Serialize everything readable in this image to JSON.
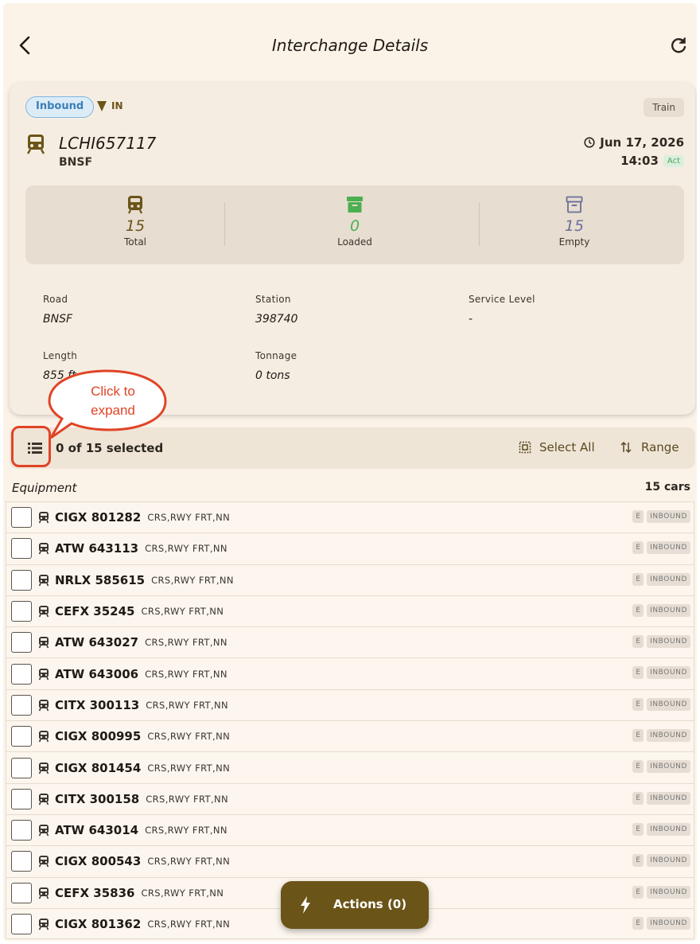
{
  "header": {
    "title": "Interchange Details"
  },
  "summary": {
    "direction_pill": "Inbound",
    "direction_tag": "IN",
    "type_badge": "Train",
    "train_id": "LCHI657117",
    "road": "BNSF",
    "date": "Jun 17, 2026",
    "time": "14:03",
    "time_status": "Act",
    "stats": [
      {
        "value": "15",
        "label": "Total",
        "color": "#6b5418"
      },
      {
        "value": "0",
        "label": "Loaded",
        "color": "#4caf50"
      },
      {
        "value": "15",
        "label": "Empty",
        "color": "#6b6f9a"
      }
    ],
    "fields": {
      "road_label": "Road",
      "road_value": "BNSF",
      "station_label": "Station",
      "station_value": "398740",
      "service_label": "Service Level",
      "service_value": "-",
      "length_label": "Length",
      "length_value": "855 ft",
      "tonnage_label": "Tonnage",
      "tonnage_value": "0 tons"
    }
  },
  "selection": {
    "count_text": "0 of 15 selected",
    "select_all_label": "Select All",
    "range_label": "Range"
  },
  "annotation": {
    "callout_line1": "Click to",
    "callout_line2": "expand"
  },
  "equipment": {
    "heading": "Equipment",
    "count": "15 cars",
    "rows": [
      {
        "id": "CIGX 801282",
        "desc": "CRS,RWY FRT,NN",
        "load": "E",
        "status": "INBOUND"
      },
      {
        "id": "ATW 643113",
        "desc": "CRS,RWY FRT,NN",
        "load": "E",
        "status": "INBOUND"
      },
      {
        "id": "NRLX 585615",
        "desc": "CRS,RWY FRT,NN",
        "load": "E",
        "status": "INBOUND"
      },
      {
        "id": "CEFX 35245",
        "desc": "CRS,RWY FRT,NN",
        "load": "E",
        "status": "INBOUND"
      },
      {
        "id": "ATW 643027",
        "desc": "CRS,RWY FRT,NN",
        "load": "E",
        "status": "INBOUND"
      },
      {
        "id": "ATW 643006",
        "desc": "CRS,RWY FRT,NN",
        "load": "E",
        "status": "INBOUND"
      },
      {
        "id": "CITX 300113",
        "desc": "CRS,RWY FRT,NN",
        "load": "E",
        "status": "INBOUND"
      },
      {
        "id": "CIGX 800995",
        "desc": "CRS,RWY FRT,NN",
        "load": "E",
        "status": "INBOUND"
      },
      {
        "id": "CIGX 801454",
        "desc": "CRS,RWY FRT,NN",
        "load": "E",
        "status": "INBOUND"
      },
      {
        "id": "CITX 300158",
        "desc": "CRS,RWY FRT,NN",
        "load": "E",
        "status": "INBOUND"
      },
      {
        "id": "ATW 643014",
        "desc": "CRS,RWY FRT,NN",
        "load": "E",
        "status": "INBOUND"
      },
      {
        "id": "CIGX 800543",
        "desc": "CRS,RWY FRT,NN",
        "load": "E",
        "status": "INBOUND"
      },
      {
        "id": "CEFX 35836",
        "desc": "CRS,RWY FRT,NN",
        "load": "E",
        "status": "INBOUND"
      },
      {
        "id": "CIGX 801362",
        "desc": "CRS,RWY FRT,NN",
        "load": "E",
        "status": "INBOUND"
      }
    ]
  },
  "actions": {
    "label": "Actions (0)"
  }
}
